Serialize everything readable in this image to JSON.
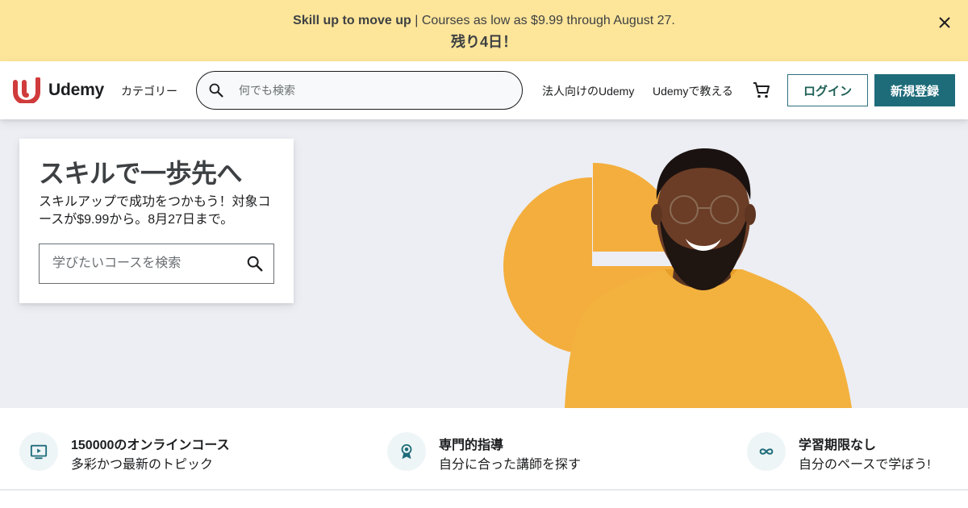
{
  "banner": {
    "bold": "Skill up to move up",
    "rest": " | Courses as low as $9.99 through August 27.",
    "countdown": "残り4日！"
  },
  "header": {
    "logo_text": "Udemy",
    "categories": "カテゴリー",
    "search_placeholder": "何でも検索",
    "business_link": "法人向けのUdemy",
    "teach_link": "Udemyで教える",
    "login": "ログイン",
    "signup": "新規登録"
  },
  "hero": {
    "title": "スキルで一歩先へ",
    "subtitle": "スキルアップで成功をつかもう！対象コースが$9.99から。8月27日まで。",
    "search_placeholder": "学びたいコースを検索"
  },
  "features": [
    {
      "icon": "play-screen-icon",
      "title": "150000のオンラインコース",
      "desc": "多彩かつ最新のトピック"
    },
    {
      "icon": "award-badge-icon",
      "title": "専門的指導",
      "desc": "自分に合った講師を探す"
    },
    {
      "icon": "infinity-icon",
      "title": "学習期限なし",
      "desc": "自分のペースで学ぼう!"
    }
  ],
  "colors": {
    "banner_bg": "#fde59a",
    "brand_red": "#a435f0",
    "accent_teal": "#1e6c7a",
    "hero_bg": "#eceef3",
    "hero_orange": "#f4ae3d"
  }
}
